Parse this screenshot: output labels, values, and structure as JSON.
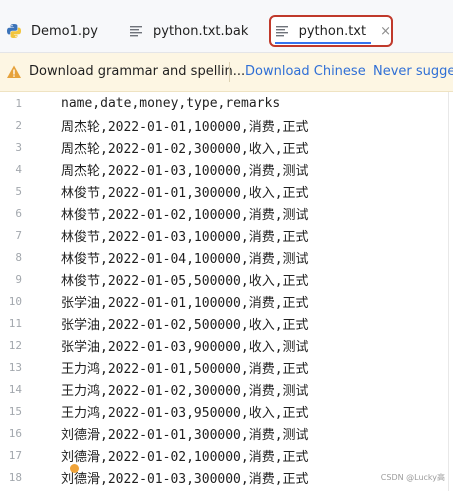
{
  "tabs": [
    {
      "label": "Demo1.py",
      "icon": "python-file-icon",
      "active": false
    },
    {
      "label": "python.txt.bak",
      "icon": "text-file-icon",
      "active": false
    },
    {
      "label": "python.txt",
      "icon": "text-file-icon",
      "active": true,
      "close": "×"
    }
  ],
  "notification": {
    "message": "Download grammar and spellin...",
    "action_download": "Download Chinese",
    "action_never": "Never sugges",
    "icon": "warning-icon"
  },
  "editor": {
    "lines": [
      {
        "n": "1",
        "text": "name,date,money,type,remarks"
      },
      {
        "n": "2",
        "text": "周杰轮,2022-01-01,100000,消费,正式"
      },
      {
        "n": "3",
        "text": "周杰轮,2022-01-02,300000,收入,正式"
      },
      {
        "n": "4",
        "text": "周杰轮,2022-01-03,100000,消费,测试"
      },
      {
        "n": "5",
        "text": "林俊节,2022-01-01,300000,收入,正式"
      },
      {
        "n": "6",
        "text": "林俊节,2022-01-02,100000,消费,测试"
      },
      {
        "n": "7",
        "text": "林俊节,2022-01-03,100000,消费,正式"
      },
      {
        "n": "8",
        "text": "林俊节,2022-01-04,100000,消费,测试"
      },
      {
        "n": "9",
        "text": "林俊节,2022-01-05,500000,收入,正式"
      },
      {
        "n": "10",
        "text": "张学油,2022-01-01,100000,消费,正式"
      },
      {
        "n": "11",
        "text": "张学油,2022-01-02,500000,收入,正式"
      },
      {
        "n": "12",
        "text": "张学油,2022-01-03,900000,收入,测试"
      },
      {
        "n": "13",
        "text": "王力鸿,2022-01-01,500000,消费,正式"
      },
      {
        "n": "14",
        "text": "王力鸿,2022-01-02,300000,消费,测试"
      },
      {
        "n": "15",
        "text": "王力鸿,2022-01-03,950000,收入,正式"
      },
      {
        "n": "16",
        "text": "刘德滑,2022-01-01,300000,消费,测试"
      },
      {
        "n": "17",
        "text": "刘德滑,2022-01-02,100000,消费,正式"
      },
      {
        "n": "18",
        "text": "刘德滑,2022-01-03,300000,消费,正式"
      }
    ]
  },
  "watermark": "CSDN @Lucky高",
  "colors": {
    "accent": "#3574f0",
    "highlight_border": "#c0392b",
    "notification_bg": "#fdf6e3",
    "link": "#2f6fd6",
    "warning": "#e6a23c"
  }
}
